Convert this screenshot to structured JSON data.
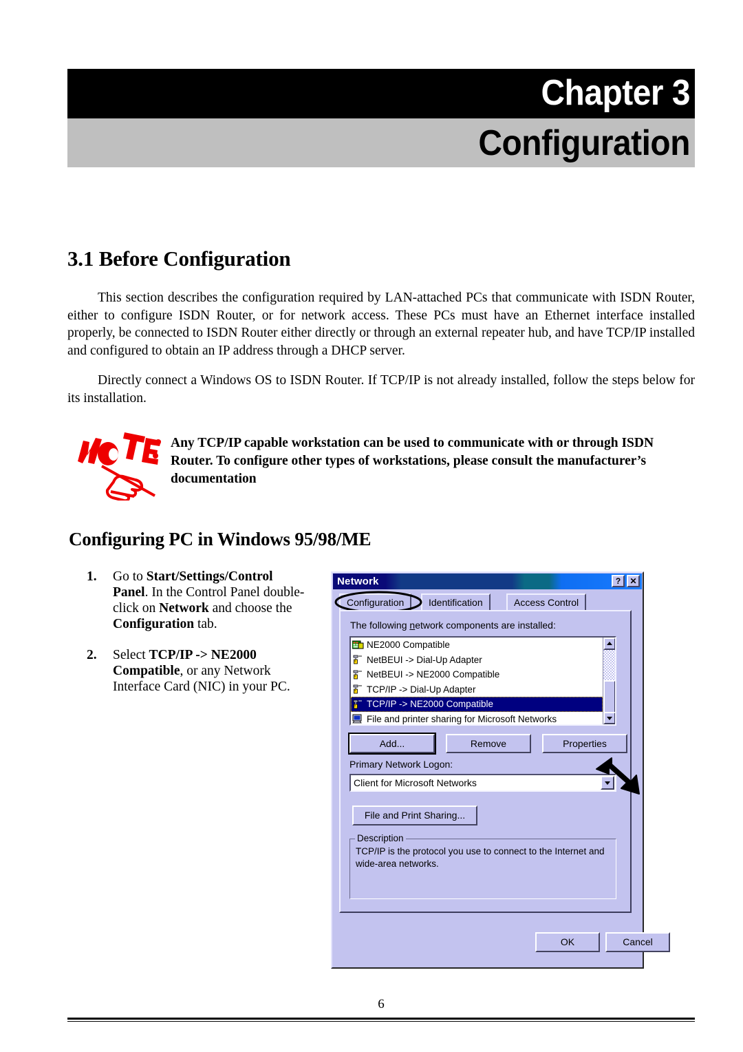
{
  "banner": {
    "chapter_label": "Chapter 3",
    "chapter_title": "Configuration"
  },
  "section": {
    "heading": "3.1 Before Configuration",
    "paragraph_1": "This section describes the configuration required by LAN-attached PCs that communicate with ISDN Router, either to configure ISDN Router, or for network access. These PCs must have an Ethernet interface installed properly, be connected to ISDN Router either directly or through an external repeater hub, and have TCP/IP installed and configured to obtain an IP address through a DHCP server.",
    "paragraph_2": "Directly connect a Windows OS to ISDN Router. If TCP/IP is not already installed, follow the steps below for its installation."
  },
  "note": {
    "icon_label": "NOTE:",
    "text": "Any TCP/IP capable workstation can be used to communicate with or through ISDN Router. To configure other types of workstations, please consult the manufacturer’s documentation"
  },
  "subsection": {
    "heading": "Configuring PC in Windows 95/98/ME",
    "steps": [
      {
        "num": "1.",
        "text_html": "Go to <b>Start/Settings/Control Panel</b>. In the Control Panel double-click on <b>Network</b> and choose the <b>Configuration</b> tab."
      },
      {
        "num": "2.",
        "text_html": "Select <b>TCP/IP -&gt; NE2000 Compatible</b>, or any Network Interface Card (NIC) in your PC."
      }
    ]
  },
  "dialog": {
    "title": "Network",
    "titlebar_buttons": [
      {
        "name": "help-button",
        "glyph": "?"
      },
      {
        "name": "close-button",
        "glyph": "✕"
      }
    ],
    "tabs": [
      {
        "label": "Configuration",
        "selected": true,
        "annotated": true
      },
      {
        "label": "Identification",
        "selected": false,
        "annotated": false
      },
      {
        "label": "Access Control",
        "selected": false,
        "annotated": false
      }
    ],
    "components_label": "The following network components are installed:",
    "components": [
      {
        "label": "NE2000 Compatible",
        "icon": "network-adapter-icon",
        "selected": false
      },
      {
        "label": "NetBEUI -> Dial-Up Adapter",
        "icon": "protocol-icon",
        "selected": false
      },
      {
        "label": "NetBEUI -> NE2000 Compatible",
        "icon": "protocol-icon",
        "selected": false
      },
      {
        "label": "TCP/IP -> Dial-Up Adapter",
        "icon": "protocol-icon",
        "selected": false
      },
      {
        "label": "TCP/IP -> NE2000 Compatible",
        "icon": "protocol-icon",
        "selected": true
      },
      {
        "label": "File and printer sharing for Microsoft Networks",
        "icon": "file-print-sharing-icon",
        "selected": false
      }
    ],
    "buttons": {
      "add": "Add...",
      "remove": "Remove",
      "properties": "Properties",
      "file_print_sharing": "File and Print Sharing...",
      "ok": "OK",
      "cancel": "Cancel"
    },
    "primary_logon_label": "Primary Network Logon:",
    "primary_logon_value": "Client for Microsoft Networks",
    "description_legend": "Description",
    "description_text": "TCP/IP is the protocol you use to connect to the Internet and wide-area networks.",
    "colors": {
      "dialog_face": "#c3c3ef",
      "titlebar_start": "#0a0a78",
      "titlebar_end": "#1a7cff",
      "selection": "#000080",
      "note_red": "#ee0000",
      "banner_gray": "#bfbfbf"
    }
  },
  "footer": {
    "page_number": "6"
  }
}
